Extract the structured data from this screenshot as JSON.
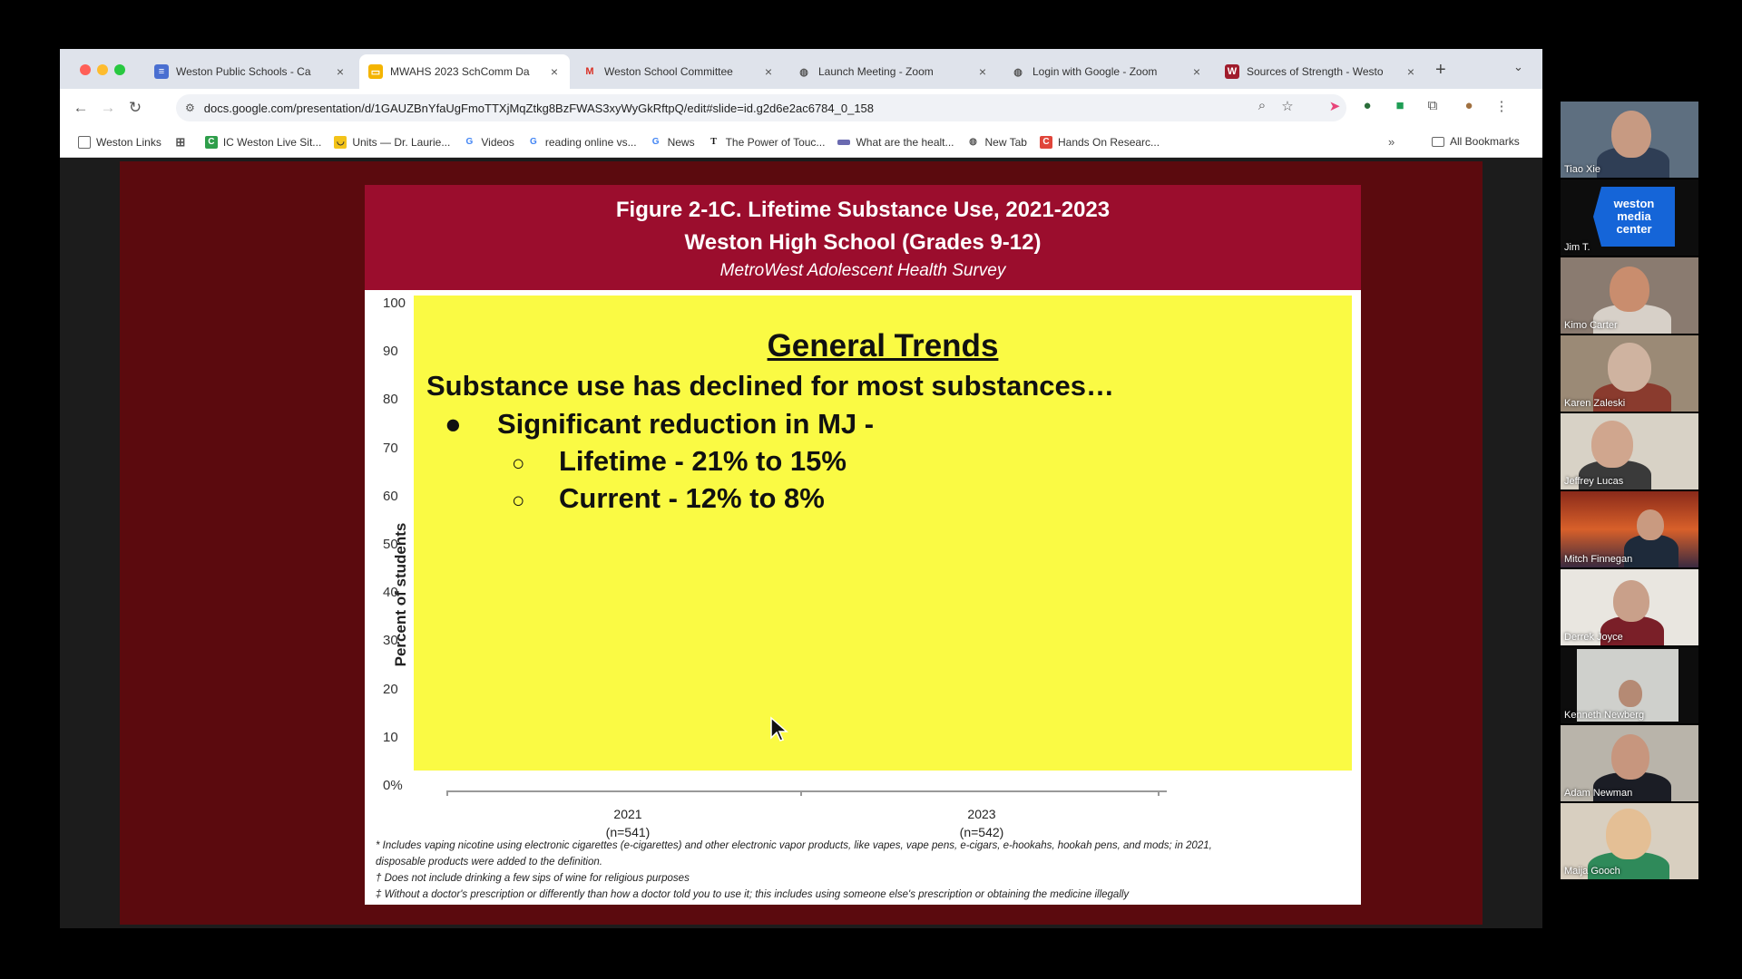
{
  "browser": {
    "tabs": [
      {
        "label": "Weston Public Schools - Ca",
        "icon": "google-docs-icon",
        "active": false
      },
      {
        "label": "MWAHS 2023 SchComm Da",
        "icon": "google-slides-icon",
        "active": true
      },
      {
        "label": "Weston School Committee",
        "icon": "gmail-icon",
        "active": false
      },
      {
        "label": "Launch Meeting - Zoom",
        "icon": "globe-icon",
        "active": false
      },
      {
        "label": "Login with Google - Zoom",
        "icon": "globe-icon",
        "active": false
      },
      {
        "label": "Sources of Strength - Westo",
        "icon": "w-site-icon",
        "active": false
      }
    ],
    "url": "docs.google.com/presentation/d/1GAUZBnYfaUgFmoTTXjMqZtkg8BzFWAS3xyWyGkRftpQ/edit#slide=id.g2d6e2ac6784_0_158",
    "bookmarks": [
      {
        "label": "Weston Links",
        "icon": "folder-link-icon"
      },
      {
        "label": "",
        "icon": "apps-grid-icon"
      },
      {
        "label": "IC Weston Live Sit...",
        "icon": "ic-icon"
      },
      {
        "label": "Units — Dr. Laurie...",
        "icon": "units-icon"
      },
      {
        "label": "Videos",
        "icon": "google-icon"
      },
      {
        "label": "reading online vs...",
        "icon": "google-icon"
      },
      {
        "label": "News",
        "icon": "google-icon"
      },
      {
        "label": "The Power of Touc...",
        "icon": "nyt-icon"
      },
      {
        "label": "What are the healt...",
        "icon": "site-icon"
      },
      {
        "label": "New Tab",
        "icon": "globe-icon"
      },
      {
        "label": "Hands On Researc...",
        "icon": "hands-on-icon"
      }
    ],
    "all_bookmarks": "All Bookmarks"
  },
  "slide": {
    "title": "Figure 2-1C. Lifetime Substance Use, 2021-2023",
    "subtitle": "Weston High School (Grades 9-12)",
    "survey": "MetroWest Adolescent Health Survey",
    "ylabel": "Percent of students",
    "yticks": [
      "100",
      "90",
      "80",
      "70",
      "60",
      "50",
      "40",
      "30",
      "20",
      "10",
      "0%"
    ],
    "xcats": [
      {
        "year": "2021",
        "n": "(n=541)"
      },
      {
        "year": "2023",
        "n": "(n=542)"
      }
    ],
    "overlay": {
      "heading": "General Trends",
      "line": "Substance use has declined for most substances…",
      "bullet": "Significant reduction in MJ -",
      "subs": [
        "Lifetime - 21% to 15%",
        "Current - 12% to 8%"
      ]
    },
    "footnotes": [
      "* Includes vaping nicotine using electronic cigarettes (e-cigarettes) and other electronic vapor products, like vapes, vape pens, e-cigars, e-hookahs, hookah pens, and mods; in 2021,",
      "disposable products were added to the definition.",
      "† Does not include drinking a few sips of wine for religious purposes",
      "‡ Without a doctor's prescription or differently than how a doctor told you to use it; this includes using someone else's prescription or obtaining the medicine illegally"
    ]
  },
  "participants": [
    {
      "name": "Tiao Xie"
    },
    {
      "name": "Jim T.",
      "logo": "weston media center"
    },
    {
      "name": "Kimo Carter"
    },
    {
      "name": "Karen Zaleski"
    },
    {
      "name": "Jeffrey Lucas"
    },
    {
      "name": "Mitch Finnegan"
    },
    {
      "name": "Derrek Joyce"
    },
    {
      "name": "Kenneth Newberg"
    },
    {
      "name": "Adam Newman"
    },
    {
      "name": "Maija Gooch"
    }
  ]
}
